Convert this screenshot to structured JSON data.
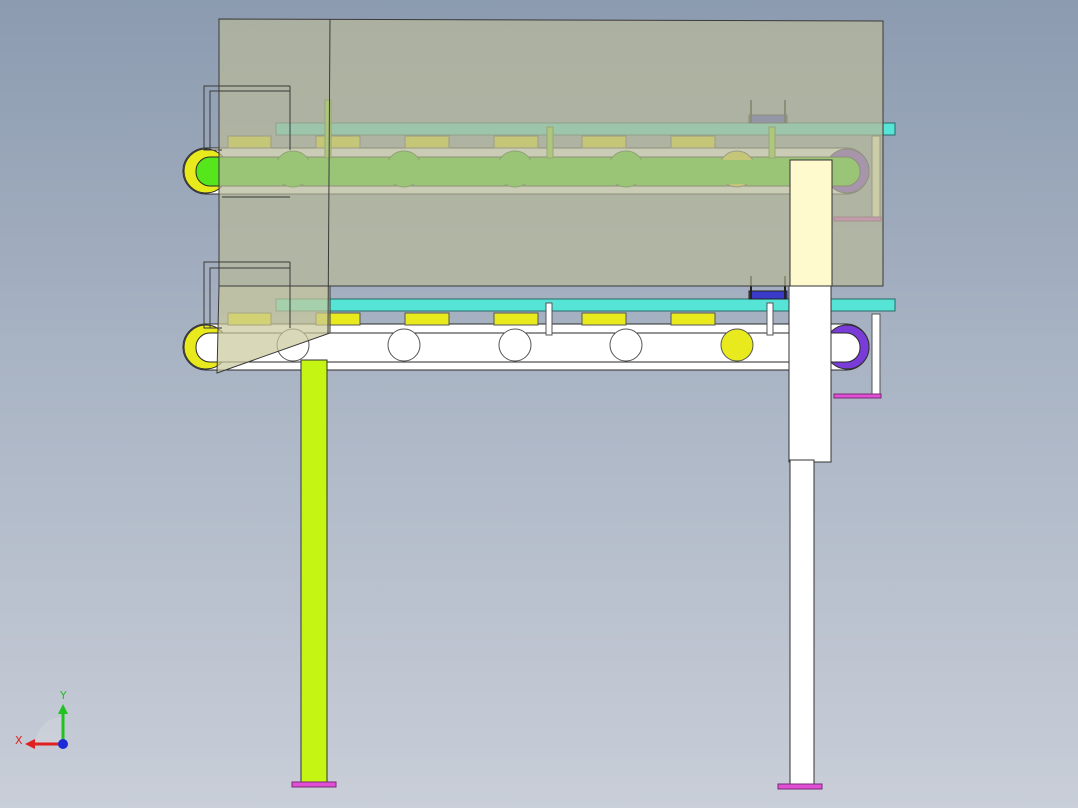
{
  "viewport": {
    "background_top": "#8c9bb0",
    "background_bottom": "#c9ced8"
  },
  "triad": {
    "x_label": "X",
    "y_label": "Y",
    "x_color": "#e0201e",
    "y_color": "#1fc21f",
    "z_color": "#1c2bd6"
  },
  "colors": {
    "frame_translucent": "#b7b99a",
    "conveyor_green": "#55e61c",
    "roller_yellow": "#e8ea1e",
    "belt_white": "#ffffff",
    "rail_cyan": "#56e4d6",
    "leg_yellowgreen": "#c5f512",
    "foot_magenta": "#e14fd6",
    "pulley_purple": "#7a3cd8",
    "bracket_blue": "#3a3ac8",
    "column_cream": "#fffacd"
  }
}
